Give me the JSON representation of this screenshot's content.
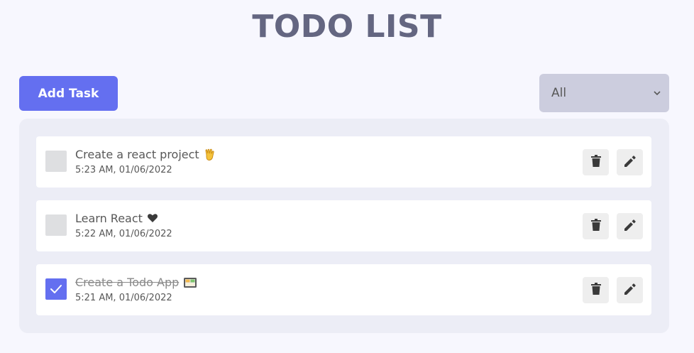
{
  "header": {
    "title": "TODO LIST"
  },
  "toolbar": {
    "add_label": "Add Task",
    "filter_selected": "All"
  },
  "colors": {
    "primary": "#646ff0",
    "title": "#646681",
    "background": "#f7f7fe",
    "panel": "#ecedf6",
    "filter_bg": "#cccdde"
  },
  "todos": [
    {
      "title": "Create a react project",
      "emoji": "vulcan-salute-emoji",
      "time": "5:23 AM, 01/06/2022",
      "completed": false
    },
    {
      "title": "Learn React",
      "emoji": "heart-emoji",
      "time": "5:22 AM, 01/06/2022",
      "completed": false
    },
    {
      "title": "Create a Todo App",
      "emoji": "bento-box-emoji",
      "time": "5:21 AM, 01/06/2022",
      "completed": true
    }
  ]
}
